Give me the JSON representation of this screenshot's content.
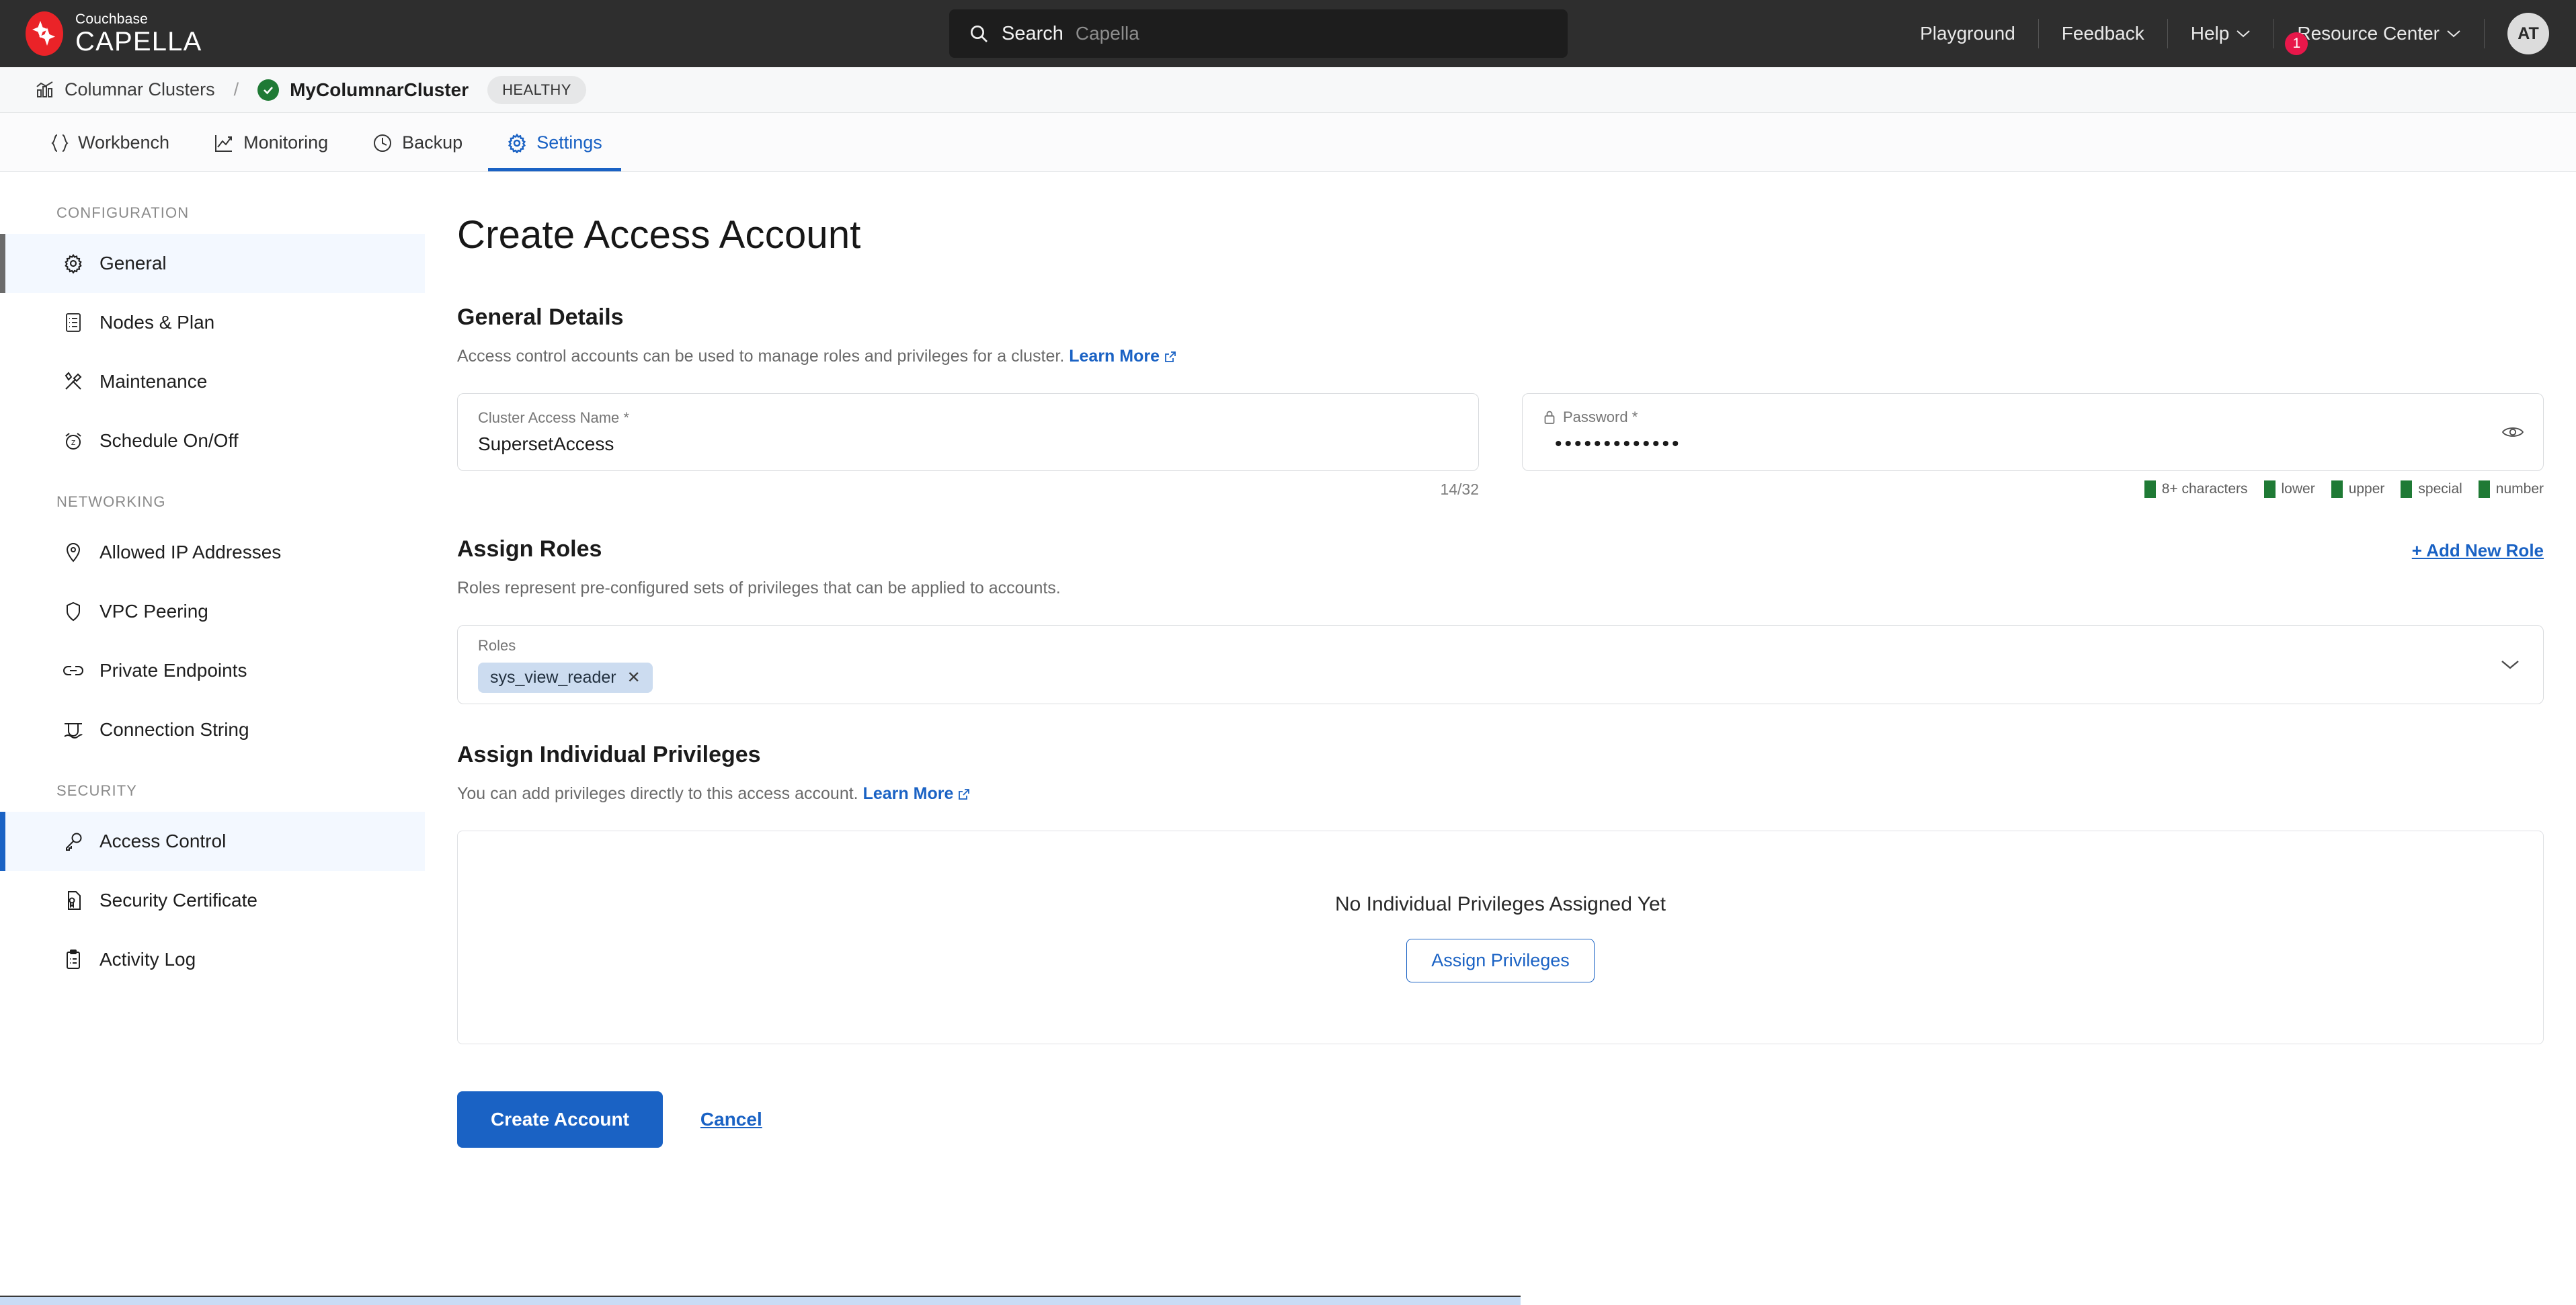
{
  "topbar": {
    "brand_sub": "Couchbase",
    "brand_main": "CAPELLA",
    "search": {
      "label": "Search",
      "placeholder": "Capella"
    },
    "links": [
      {
        "label": "Playground",
        "caret": false,
        "badge": null
      },
      {
        "label": "Feedback",
        "caret": false,
        "badge": null
      },
      {
        "label": "Help",
        "caret": true,
        "badge": null
      },
      {
        "label": "Resource Center",
        "caret": true,
        "badge": "1"
      }
    ],
    "avatar_initials": "AT"
  },
  "breadcrumb": {
    "parent": "Columnar Clusters",
    "separator": "/",
    "current": "MyColumnarCluster",
    "status": "HEALTHY"
  },
  "tabs": [
    {
      "label": "Workbench",
      "icon": "braces-icon",
      "active": false
    },
    {
      "label": "Monitoring",
      "icon": "chart-line-icon",
      "active": false
    },
    {
      "label": "Backup",
      "icon": "clock-icon",
      "active": false
    },
    {
      "label": "Settings",
      "icon": "gear-icon",
      "active": true
    }
  ],
  "sidebar": {
    "groups": [
      {
        "label": "CONFIGURATION",
        "items": [
          {
            "label": "General",
            "icon": "gear-icon",
            "active": true,
            "accent": "gray"
          },
          {
            "label": "Nodes & Plan",
            "icon": "list-document-icon",
            "active": false
          },
          {
            "label": "Maintenance",
            "icon": "tools-icon",
            "active": false
          },
          {
            "label": "Schedule On/Off",
            "icon": "alarm-clock-icon",
            "active": false
          }
        ]
      },
      {
        "label": "NETWORKING",
        "items": [
          {
            "label": "Allowed IP Addresses",
            "icon": "map-pin-icon",
            "active": false
          },
          {
            "label": "VPC Peering",
            "icon": "shield-icon",
            "active": false
          },
          {
            "label": "Private Endpoints",
            "icon": "link-icon",
            "active": false
          },
          {
            "label": "Connection String",
            "icon": "connection-icon",
            "active": false
          }
        ]
      },
      {
        "label": "SECURITY",
        "items": [
          {
            "label": "Access Control",
            "icon": "key-icon",
            "active": true,
            "accent": "blue"
          },
          {
            "label": "Security Certificate",
            "icon": "certificate-icon",
            "active": false
          },
          {
            "label": "Activity Log",
            "icon": "clipboard-icon",
            "active": false
          }
        ]
      }
    ]
  },
  "main": {
    "page_title": "Create Access Account",
    "general_details": {
      "title": "General Details",
      "description": "Access control accounts can be used to manage roles and privileges for a cluster.",
      "learn_more": "Learn More",
      "name_field": {
        "label": "Cluster Access Name *",
        "value": "SupersetAccess",
        "counter": "14/32"
      },
      "password_field": {
        "label": "Password *",
        "value": "•••••••••••••",
        "rules": [
          "8+ characters",
          "lower",
          "upper",
          "special",
          "number"
        ]
      }
    },
    "assign_roles": {
      "title": "Assign Roles",
      "description": "Roles represent pre-configured sets of privileges that can be applied to accounts.",
      "add_new": "+ Add New Role",
      "field_label": "Roles",
      "chips": [
        "sys_view_reader"
      ]
    },
    "assign_privileges": {
      "title": "Assign Individual Privileges",
      "description": "You can add privileges directly to this access account.",
      "learn_more": "Learn More",
      "empty_text": "No Individual Privileges Assigned Yet",
      "empty_button": "Assign Privileges"
    },
    "actions": {
      "primary": "Create Account",
      "secondary": "Cancel"
    }
  },
  "colors": {
    "accent_blue": "#1a62c4",
    "brand_red": "#ea2328",
    "topbar_bg": "#2e2e2e",
    "healthy_green": "#1f7a35",
    "badge_red": "#e8174a"
  }
}
